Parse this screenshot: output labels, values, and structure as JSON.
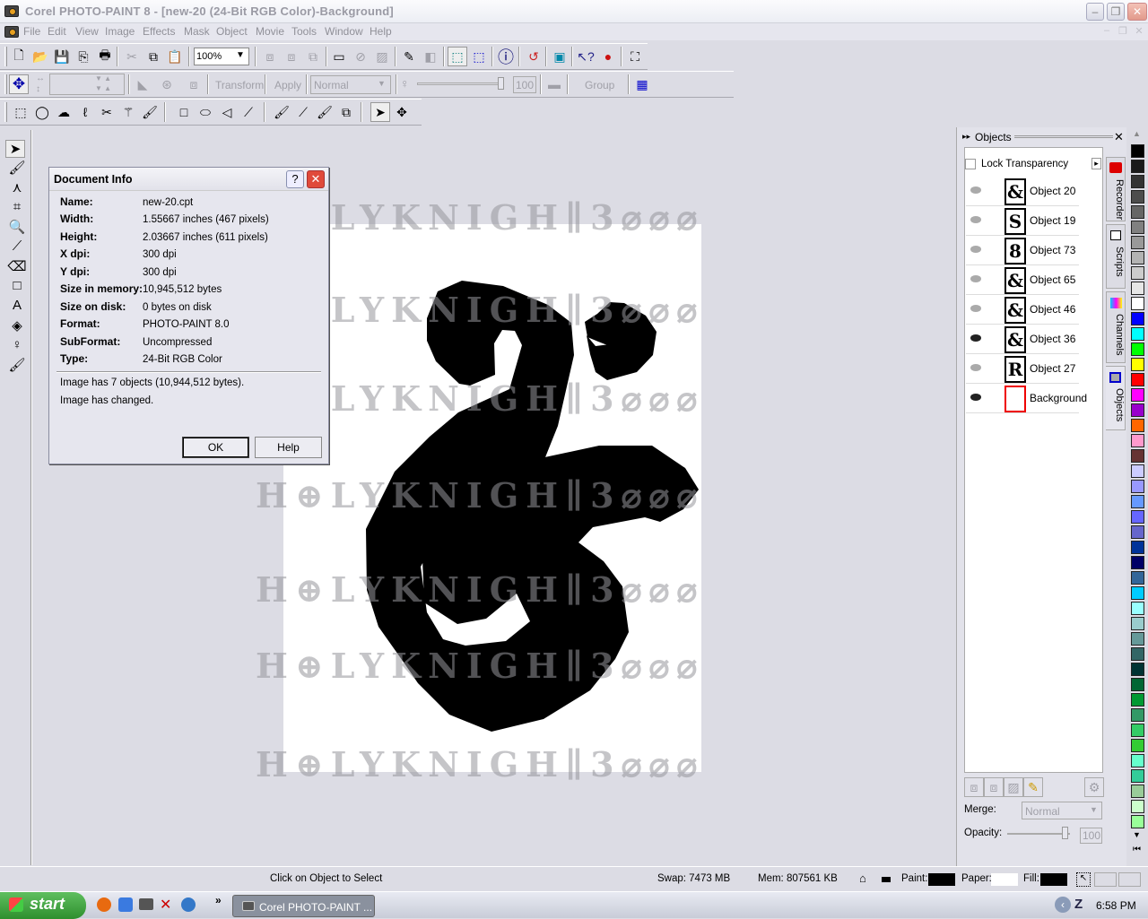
{
  "window": {
    "title": "Corel PHOTO-PAINT 8 - [new-20  (24-Bit RGB Color)-Background]",
    "controls": {
      "minimize": "–",
      "restore": "❐",
      "close": "✕"
    }
  },
  "menubar": {
    "items": [
      "File",
      "Edit",
      "View",
      "Image",
      "Effects",
      "Mask",
      "Object",
      "Movie",
      "Tools",
      "Window",
      "Help"
    ]
  },
  "toolbar_standard": {
    "zoom_value": "100%",
    "icons": [
      "new-icon",
      "open-icon",
      "save-icon",
      "copy-file-icon",
      "print-icon",
      "cut-icon",
      "copy-icon",
      "paste-icon",
      "zoom-combo",
      "combine-icon",
      "combine-all-icon",
      "object-icon",
      "mask-icon",
      "remove-mask-icon",
      "invert-mask-icon",
      "paint-on-mask-icon",
      "marquee-icon",
      "mask-marquee-icon",
      "mask-overlay-icon",
      "info-icon",
      "undo-redo-icon",
      "browser-icon",
      "whats-this-icon",
      "apple-icon",
      "fullscreen-icon"
    ]
  },
  "toolbar_property": {
    "transform_label": "Transform",
    "apply_label": "Apply",
    "merge_mode": "Normal",
    "opacity_value": "100",
    "group_label": "Group"
  },
  "toolbar_mask": {
    "icons": [
      "rectangle-mask-icon",
      "ellipse-mask-icon",
      "freehand-mask-icon",
      "lasso-mask-icon",
      "scissors-mask-icon",
      "magic-wand-icon",
      "brush-mask-icon",
      "rectangle-icon",
      "ellipse-icon",
      "polygon-icon",
      "line-icon",
      "paint-brush-icon",
      "effect-brush-icon",
      "clone-icon",
      "image-sprayer-icon",
      "pick-tool-icon",
      "move-tool-icon"
    ]
  },
  "dialog": {
    "title": "Document Info",
    "help_icon": "?",
    "close_icon": "✕",
    "rows": [
      {
        "label": "Name:",
        "value": "new-20.cpt"
      },
      {
        "label": "Width:",
        "value": "1.55667 inches  (467 pixels)"
      },
      {
        "label": "Height:",
        "value": "2.03667 inches  (611 pixels)"
      },
      {
        "label": "X dpi:",
        "value": "300 dpi"
      },
      {
        "label": "Y dpi:",
        "value": "300 dpi"
      },
      {
        "label": "Size in memory:",
        "value": "10,945,512 bytes"
      },
      {
        "label": "Size on disk:",
        "value": "0 bytes on disk"
      },
      {
        "label": "Format:",
        "value": "PHOTO-PAINT 8.0"
      },
      {
        "label": "SubFormat:",
        "value": "Uncompressed"
      },
      {
        "label": "Type:",
        "value": "24-Bit RGB Color"
      }
    ],
    "note1": "Image has 7 objects (10,944,512 bytes).",
    "note2": "Image has changed.",
    "ok_label": "OK",
    "help_label": "Help"
  },
  "watermark": "H⊕LYKNIGH∥3⌀⌀⌀",
  "objects_panel": {
    "title": "Objects",
    "lock_transparency": "Lock Transparency",
    "objects": [
      {
        "name": "Object 20",
        "glyph": "&",
        "visible": false
      },
      {
        "name": "Object 19",
        "glyph": "S",
        "visible": false
      },
      {
        "name": "Object 73",
        "glyph": "8",
        "visible": false
      },
      {
        "name": "Object 65",
        "glyph": "&",
        "visible": false
      },
      {
        "name": "Object 46",
        "glyph": "&",
        "visible": false
      },
      {
        "name": "Object 36",
        "glyph": "&",
        "visible": true
      },
      {
        "name": "Object 27",
        "glyph": "R",
        "visible": false
      },
      {
        "name": "Background",
        "glyph": "",
        "visible": true
      }
    ],
    "merge_label": "Merge:",
    "merge_value": "Normal",
    "opacity_label": "Opacity:",
    "opacity_value": "100",
    "side_tabs": [
      "Recorder",
      "Scripts",
      "Channels",
      "Objects"
    ]
  },
  "palette": {
    "colors": [
      "#000000",
      "#1a1a1a",
      "#333333",
      "#4d4d4d",
      "#666666",
      "#808080",
      "#999999",
      "#b3b3b3",
      "#cccccc",
      "#e6e6e6",
      "#ffffff",
      "#0000ff",
      "#00ffff",
      "#00ff00",
      "#ffff00",
      "#ff0000",
      "#ff00ff",
      "#9900cc",
      "#ff6600",
      "#ff99cc",
      "#663333",
      "#ccccff",
      "#9999ff",
      "#6699ff",
      "#6666ff",
      "#6666cc",
      "#003399",
      "#000066",
      "#336699",
      "#00ccff",
      "#99ffff",
      "#99cccc",
      "#669999",
      "#336666",
      "#003333",
      "#006633",
      "#009933",
      "#339966",
      "#33cc66",
      "#33cc33",
      "#66ffcc",
      "#33cc99",
      "#99cc99",
      "#ccffcc",
      "#99ff99"
    ]
  },
  "statusbar": {
    "hint": "Click on Object to Select",
    "swap": "Swap: 7473 MB",
    "mem": "Mem: 807561 KB",
    "paint_label": "Paint:",
    "paper_label": "Paper:",
    "fill_label": "Fill:",
    "paint_color": "#000000",
    "paper_color": "#ffffff",
    "fill_color": "#000000"
  },
  "taskbar": {
    "start_label": "start",
    "quicklaunch": [
      "firefox-icon",
      "ie-icon",
      "camera-icon",
      "x-icon",
      "network-icon"
    ],
    "more": "»",
    "task_label": "Corel PHOTO-PAINT ...",
    "clock": "6:58 PM"
  }
}
